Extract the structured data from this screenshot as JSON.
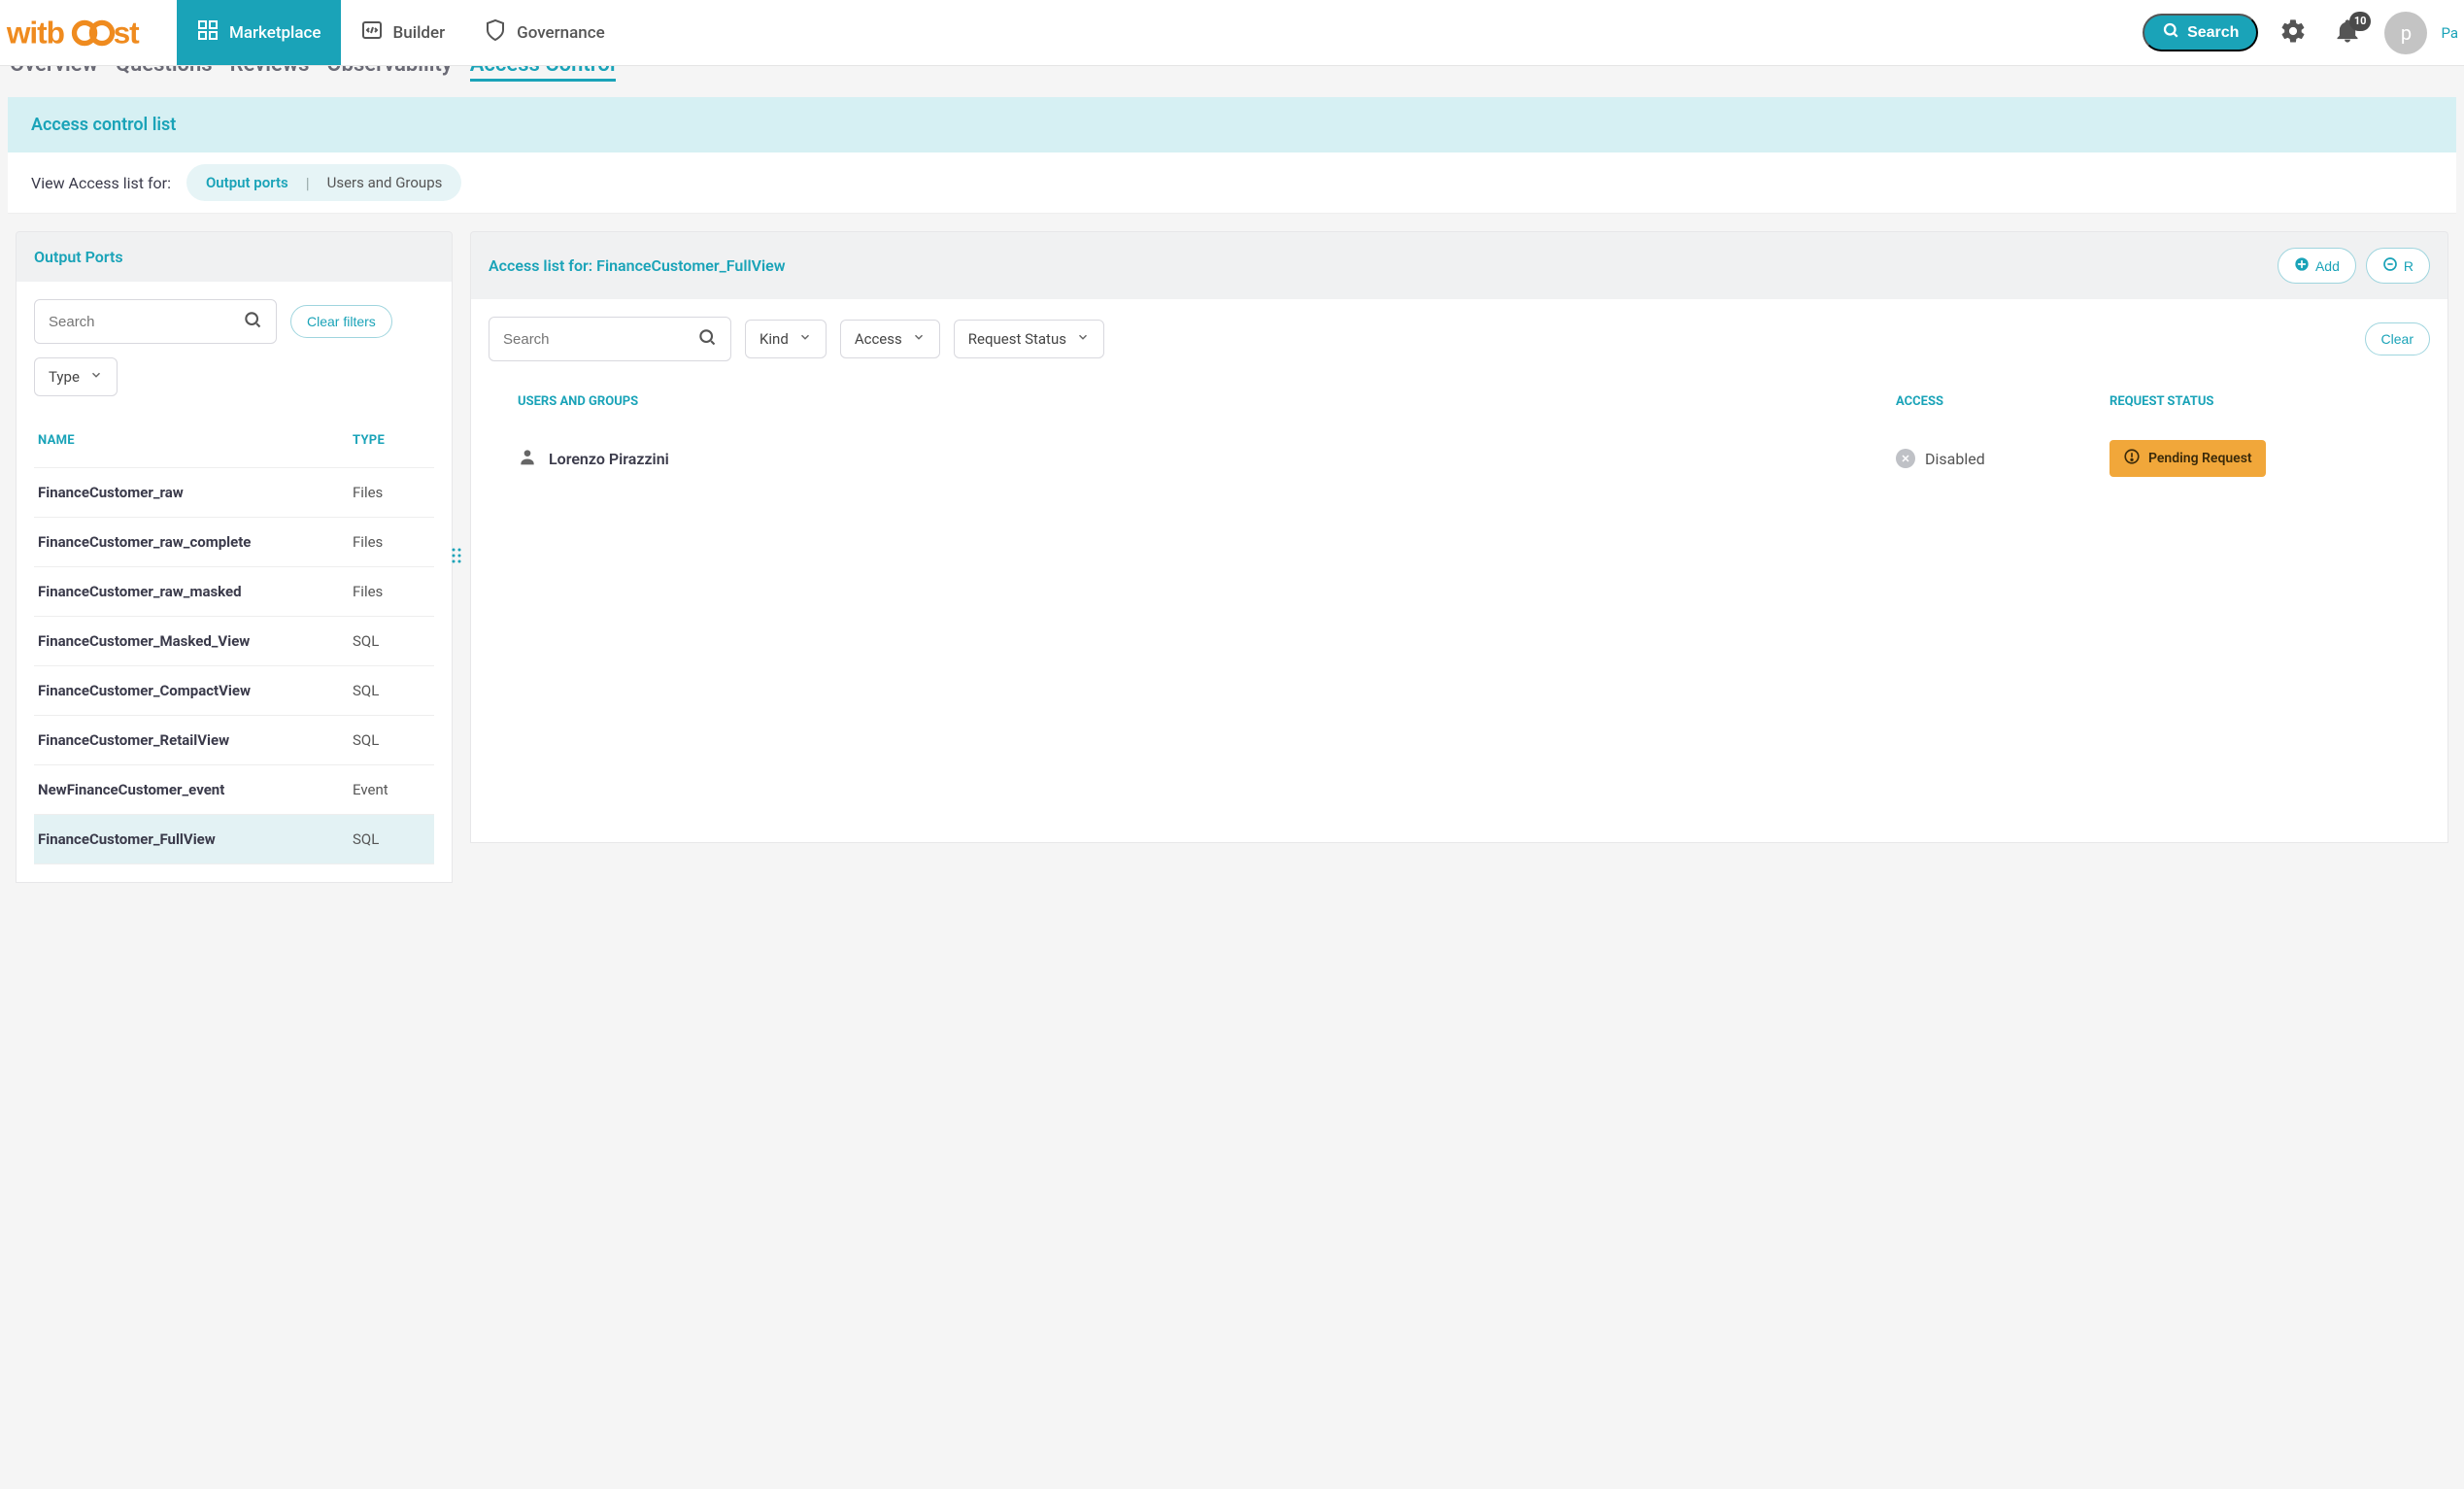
{
  "brand": "witboost",
  "nav": {
    "items": [
      {
        "label": "Marketplace",
        "icon": "grid-icon",
        "active": true
      },
      {
        "label": "Builder",
        "icon": "code-icon",
        "active": false
      },
      {
        "label": "Governance",
        "icon": "shield-icon",
        "active": false
      }
    ],
    "search_label": "Search",
    "notifications_count": "10",
    "avatar_letter": "p",
    "avatar_after": "Pa"
  },
  "subtabs": {
    "items": [
      {
        "label": "Overview",
        "active": false
      },
      {
        "label": "Questions",
        "active": false
      },
      {
        "label": "Reviews",
        "active": false
      },
      {
        "label": "Observability",
        "active": false
      },
      {
        "label": "Access Control",
        "active": true
      }
    ]
  },
  "acl_header": "Access control list",
  "view_row": {
    "prefix": "View Access list for:",
    "options": [
      {
        "label": "Output ports",
        "active": true
      },
      {
        "label": "Users and Groups",
        "active": false
      }
    ]
  },
  "output_ports_panel": {
    "title": "Output Ports",
    "search_placeholder": "Search",
    "clear_filters_label": "Clear filters",
    "type_filter_label": "Type",
    "columns": {
      "name": "NAME",
      "type": "TYPE"
    },
    "rows": [
      {
        "name": "FinanceCustomer_raw",
        "type": "Files",
        "selected": false
      },
      {
        "name": "FinanceCustomer_raw_complete",
        "type": "Files",
        "selected": false
      },
      {
        "name": "FinanceCustomer_raw_masked",
        "type": "Files",
        "selected": false
      },
      {
        "name": "FinanceCustomer_Masked_View",
        "type": "SQL",
        "selected": false
      },
      {
        "name": "FinanceCustomer_CompactView",
        "type": "SQL",
        "selected": false
      },
      {
        "name": "FinanceCustomer_RetailView",
        "type": "SQL",
        "selected": false
      },
      {
        "name": "NewFinanceCustomer_event",
        "type": "Event",
        "selected": false
      },
      {
        "name": "FinanceCustomer_FullView",
        "type": "SQL",
        "selected": true
      }
    ]
  },
  "access_list_panel": {
    "title_prefix": "Access list for: ",
    "title_subject": "FinanceCustomer_FullView",
    "add_label": "Add",
    "remove_label": "R",
    "search_placeholder": "Search",
    "filter_kind": "Kind",
    "filter_access": "Access",
    "filter_request_status": "Request Status",
    "clear_filters_label": "Clear",
    "columns": {
      "users": "USERS AND GROUPS",
      "access": "ACCESS",
      "status": "REQUEST STATUS"
    },
    "rows": [
      {
        "user": "Lorenzo Pirazzini",
        "access": "Disabled",
        "status": "Pending Request"
      }
    ]
  }
}
